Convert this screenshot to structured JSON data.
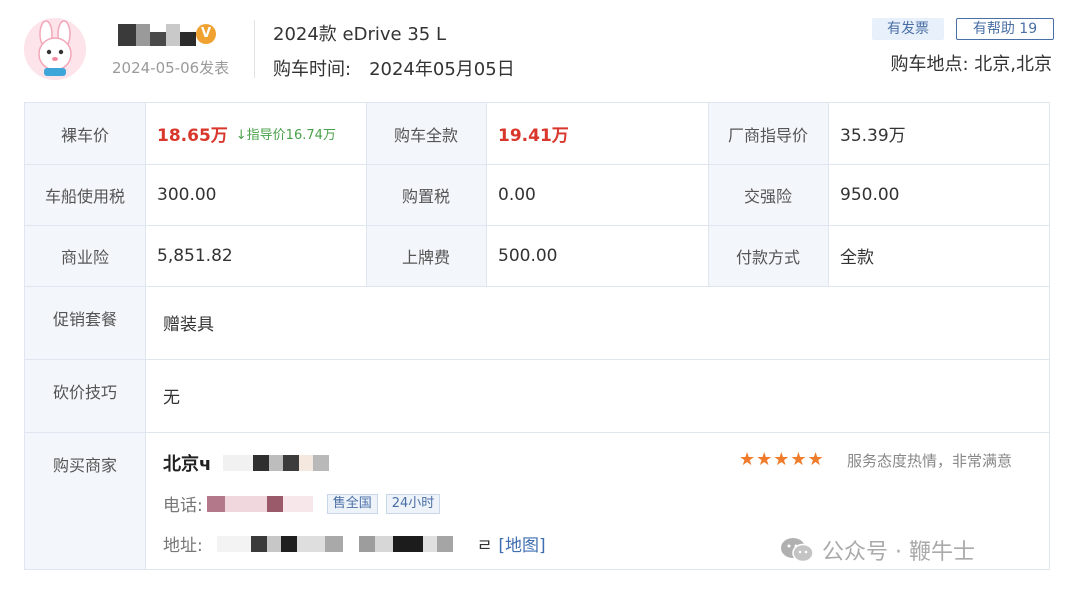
{
  "header": {
    "post_date": "2024-05-06发表",
    "verified_symbol": "V",
    "model": "2024款 eDrive 35 L",
    "buy_time_label": "购车时间:",
    "buy_time_value": "2024年05月05日",
    "badge_invoice": "有发票",
    "badge_helpful": "有帮助 19",
    "location": "购车地点: 北京,北京"
  },
  "table": {
    "bare_price_label": "裸车价",
    "bare_price_value": "18.65万",
    "guide_delta": "↓指导价16.74万",
    "total_label": "购车全款",
    "total_value": "19.41万",
    "msrp_label": "厂商指导价",
    "msrp_value": "35.39万",
    "vehicle_tax_label": "车船使用税",
    "vehicle_tax_value": "300.00",
    "purchase_tax_label": "购置税",
    "purchase_tax_value": "0.00",
    "compulsory_ins_label": "交强险",
    "compulsory_ins_value": "950.00",
    "commercial_ins_label": "商业险",
    "commercial_ins_value": "5,851.82",
    "plate_fee_label": "上牌费",
    "plate_fee_value": "500.00",
    "payment_label": "付款方式",
    "payment_value": "全款",
    "promo_label": "促销套餐",
    "promo_value": "赠装具",
    "bargain_label": "砍价技巧",
    "bargain_value": "无",
    "dealer_label": "购买商家"
  },
  "dealer": {
    "name_visible": "北京ч",
    "stars": "★★★★★",
    "rating_text": "服务态度热情，非常满意",
    "phone_label": "电话:",
    "tag_national": "售全国",
    "tag_24h": "24小时",
    "addr_label": "地址:",
    "addr_tail": "ㄹ",
    "map_link": "[地图]"
  },
  "watermark": {
    "text": "公众号 · 鞭牛士"
  }
}
